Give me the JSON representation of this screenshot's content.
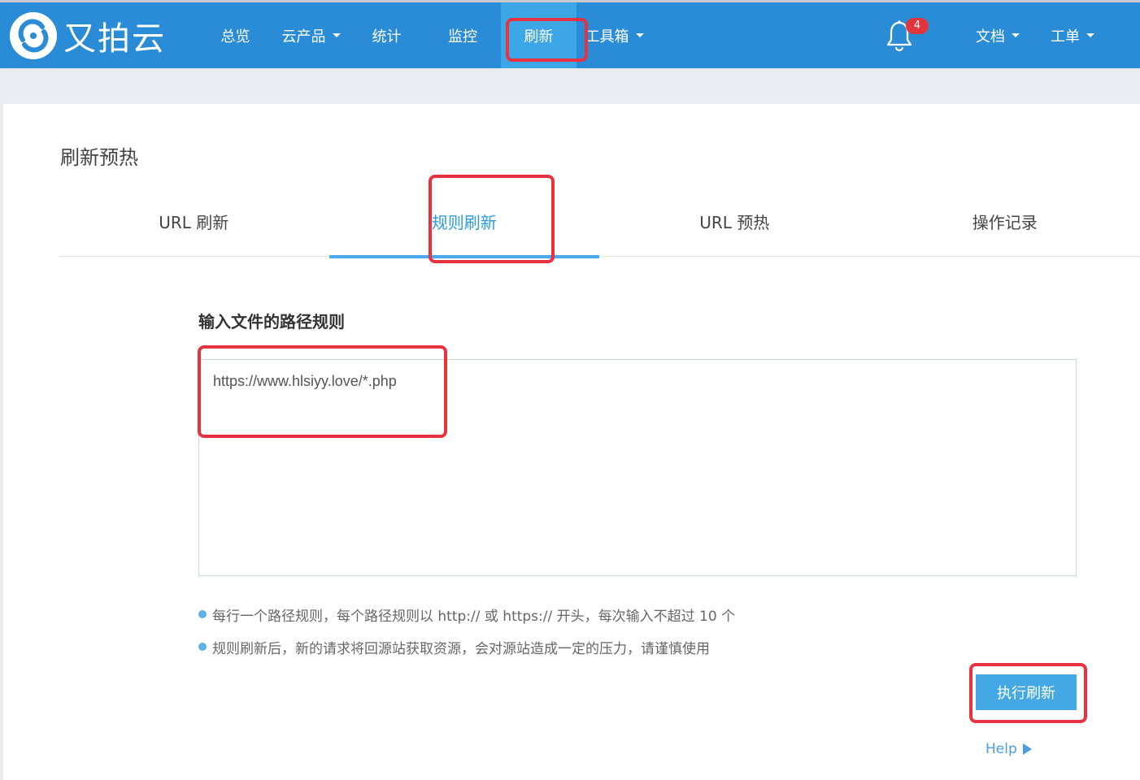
{
  "brand": {
    "name": "又拍云",
    "logo_icon": "upyun-logo-icon"
  },
  "nav": {
    "items": [
      {
        "label": "总览",
        "dropdown": false,
        "active": false
      },
      {
        "label": "云产品",
        "dropdown": true,
        "active": false
      },
      {
        "label": "统计",
        "dropdown": false,
        "active": false
      },
      {
        "label": "监控",
        "dropdown": false,
        "active": false
      },
      {
        "label": "刷新",
        "dropdown": false,
        "active": true
      },
      {
        "label": "工具箱",
        "dropdown": true,
        "active": false
      }
    ],
    "notification_count": "4",
    "docs_label": "文档",
    "ticket_label": "工单"
  },
  "page": {
    "title": "刷新预热",
    "tabs": [
      {
        "label": "URL 刷新",
        "active": false
      },
      {
        "label": "规则刷新",
        "active": true
      },
      {
        "label": "URL 预热",
        "active": false
      },
      {
        "label": "操作记录",
        "active": false
      }
    ],
    "field_label": "输入文件的路径规则",
    "textarea_value": "https://www.hlsiyy.love/*.php",
    "hints": [
      "每行一个路径规则，每个路径规则以 http:// 或 https:// 开头，每次输入不超过 10 个",
      "规则刷新后，新的请求将回源站获取资源，会对源站造成一定的压力，请谨慎使用"
    ],
    "submit_label": "执行刷新",
    "help_label": "Help"
  },
  "colors": {
    "topbar": "#2a8bd6",
    "nav_active": "#3ca6e6",
    "tab_active": "#2b9be0",
    "button": "#43a8e4",
    "highlight": "#e8323f",
    "badge": "#e0353c"
  }
}
